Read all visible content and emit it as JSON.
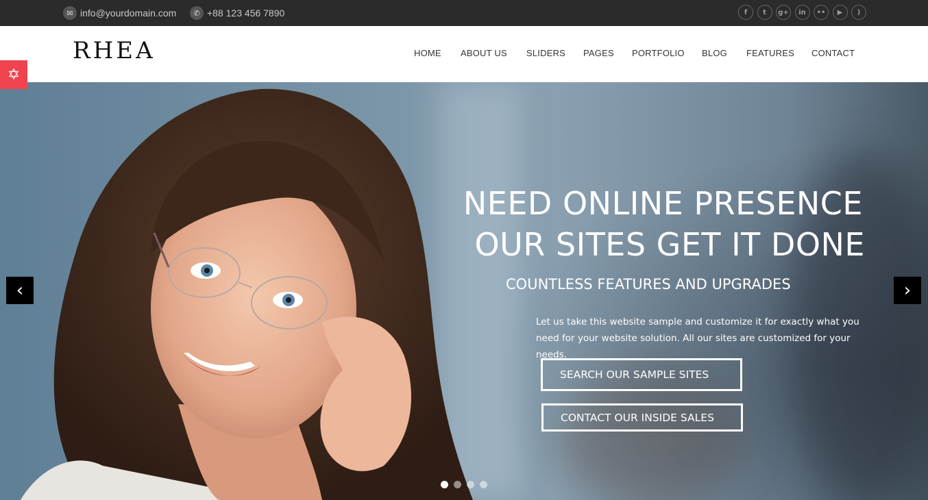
{
  "topbar": {
    "email": "info@yourdomain.com",
    "phone": "+88 123 456 7890",
    "email_icon": "envelope-icon",
    "phone_icon": "phone-icon",
    "socials": [
      {
        "name": "facebook-icon",
        "glyph": "f"
      },
      {
        "name": "twitter-icon",
        "glyph": "t"
      },
      {
        "name": "google-plus-icon",
        "glyph": "g+"
      },
      {
        "name": "linkedin-icon",
        "glyph": "in"
      },
      {
        "name": "flickr-icon",
        "glyph": "••"
      },
      {
        "name": "youtube-icon",
        "glyph": "▶"
      },
      {
        "name": "rss-icon",
        "glyph": ")"
      }
    ]
  },
  "header": {
    "logo": "RHEA",
    "nav": [
      "HOME",
      "ABOUT US",
      "SLIDERS",
      "PAGES",
      "PORTFOLIO",
      "BLOG",
      "FEATURES",
      "CONTACT"
    ]
  },
  "hero": {
    "headline_line1": "NEED ONLINE PRESENCE",
    "headline_line2": "OUR SITES GET IT DONE",
    "subheadline": "COUNTLESS FEATURES AND UPGRADES",
    "paragraph": "Let us take this website sample and customize it for exactly what you need for your website solution. All our sites are customized for your needs.",
    "button_primary": "SEARCH OUR SAMPLE SITES",
    "button_secondary": "CONTACT OUR INSIDE SALES",
    "prev_glyph": "‹",
    "next_glyph": "›",
    "slide_count": 4,
    "active_slide": 1
  },
  "colors": {
    "topbar_bg": "#2b2b2b",
    "accent_tab": "#f0434f"
  }
}
